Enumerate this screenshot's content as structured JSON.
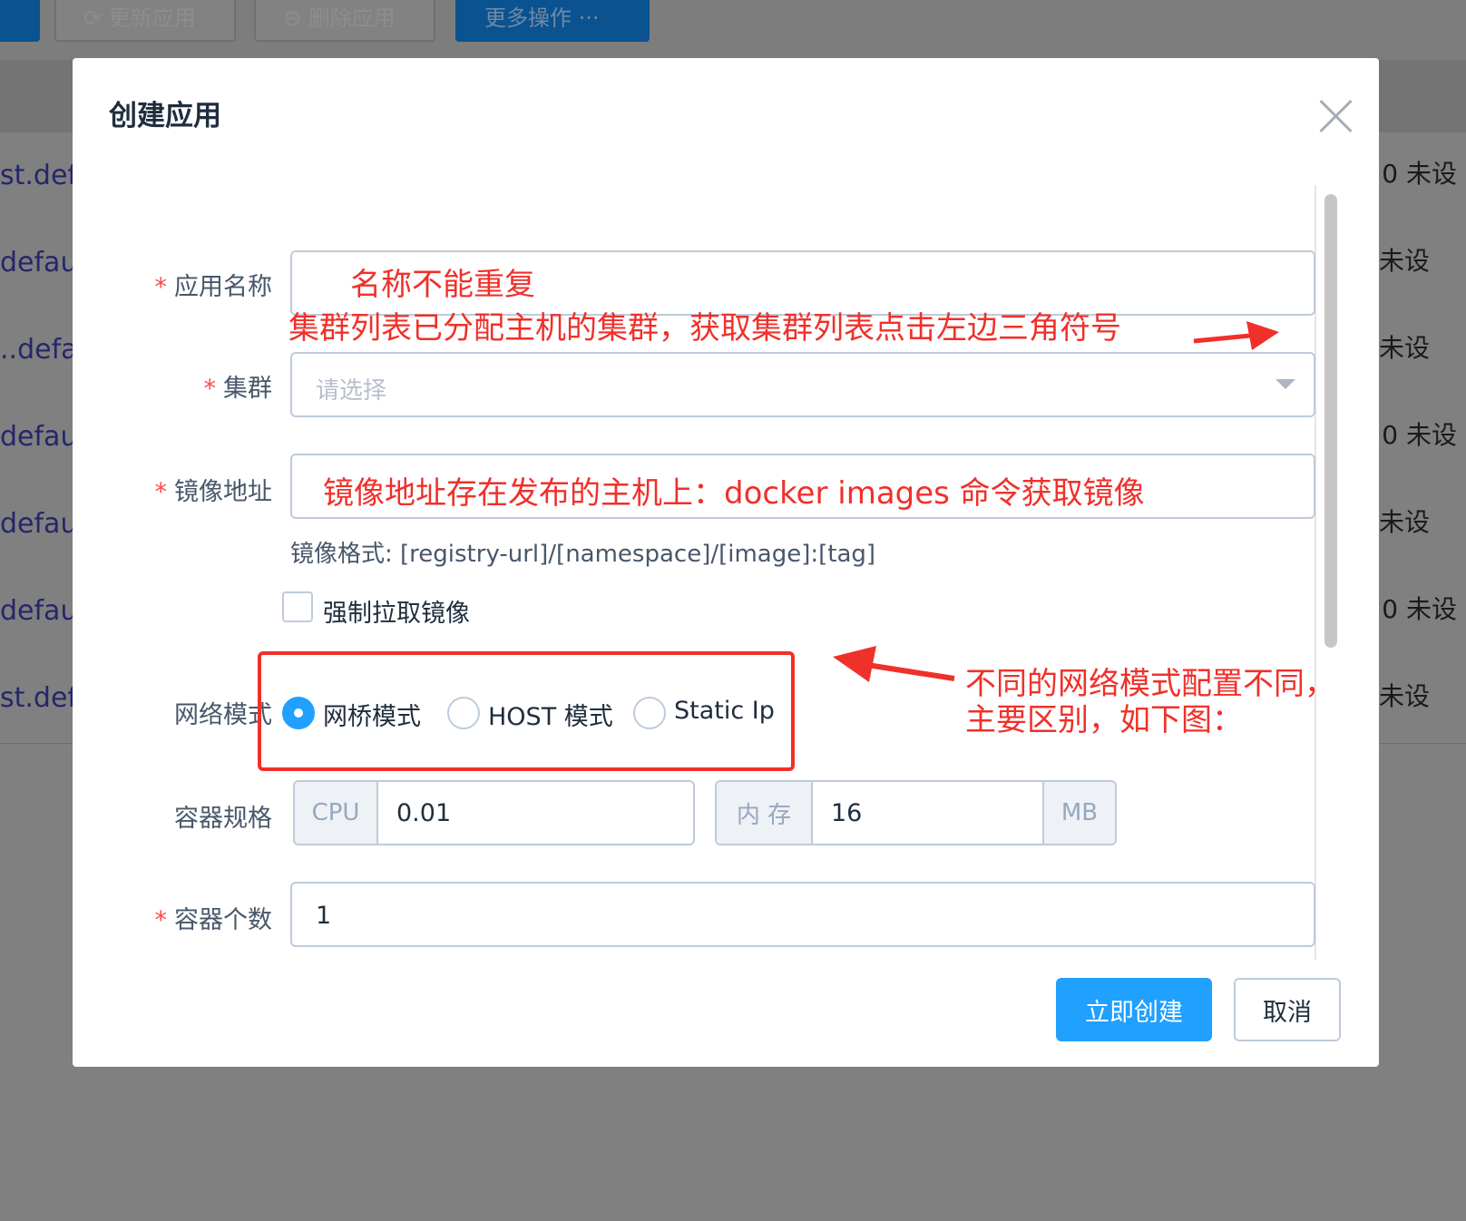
{
  "background": {
    "toolbar_buttons": [
      {
        "label": "更新应用",
        "icon": "refresh-icon"
      },
      {
        "label": "删除应用",
        "icon": "minus-circle-icon"
      },
      {
        "label": "更多操作 ···"
      }
    ],
    "rows": [
      {
        "left": "st.defa",
        "right": "0 未设"
      },
      {
        "left": "default.",
        "right": "未设"
      },
      {
        "left": "..defau",
        "right": "未设"
      },
      {
        "left": "default.",
        "right": "0 未设"
      },
      {
        "left": "default",
        "right": "未设"
      },
      {
        "left": "default.",
        "right": "0 未设"
      },
      {
        "left": "st.defa",
        "right": "未设"
      }
    ]
  },
  "modal": {
    "title": "创建应用",
    "required_mark": "*",
    "fields": {
      "app_name": {
        "label": "应用名称",
        "annotation": "名称不能重复"
      },
      "cluster": {
        "label": "集群",
        "placeholder": "请选择",
        "annotation": "集群列表已分配主机的集群，获取集群列表点击左边三角符号"
      },
      "image": {
        "label": "镜像地址",
        "annotation": "镜像地址存在发布的主机上：docker images 命令获取镜像",
        "hint": "镜像格式: [registry-url]/[namespace]/[image]:[tag]"
      },
      "force_pull": {
        "label": "强制拉取镜像",
        "checked": false
      },
      "network": {
        "label": "网络模式",
        "options": [
          {
            "label": "网桥模式",
            "selected": true
          },
          {
            "label": "HOST 模式",
            "selected": false
          },
          {
            "label": "Static Ip",
            "selected": false
          }
        ],
        "annotation_line1": "不同的网络模式配置不同，",
        "annotation_line2": "主要区别，如下图："
      },
      "spec": {
        "label": "容器规格",
        "cpu_addon": "CPU",
        "cpu_value": "0.01",
        "mem_addon": "内 存",
        "mem_value": "16",
        "mem_unit": "MB"
      },
      "count": {
        "label": "容器个数",
        "value": "1"
      }
    },
    "buttons": {
      "create": "立即创建",
      "cancel": "取消"
    }
  },
  "colors": {
    "primary": "#20a0ff",
    "annotation": "#f0302a",
    "required": "#ff4949"
  }
}
